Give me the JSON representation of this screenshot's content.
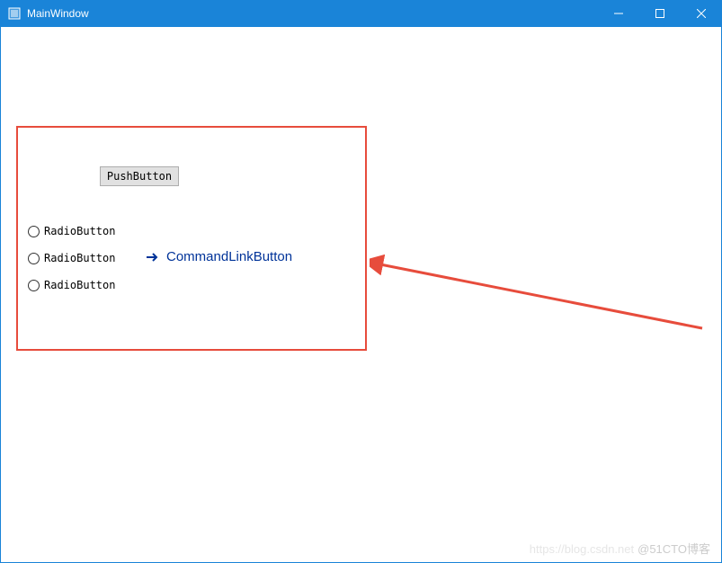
{
  "window": {
    "title": "MainWindow"
  },
  "buttons": {
    "push_button": "PushButton",
    "command_link": "CommandLinkButton"
  },
  "radios": [
    {
      "label": "RadioButton"
    },
    {
      "label": "RadioButton"
    },
    {
      "label": "RadioButton"
    }
  ],
  "annotation": {
    "highlight_color": "#e74c3c"
  },
  "watermark": {
    "faint": "https://blog.csdn.net",
    "text": "@51CTO博客"
  }
}
